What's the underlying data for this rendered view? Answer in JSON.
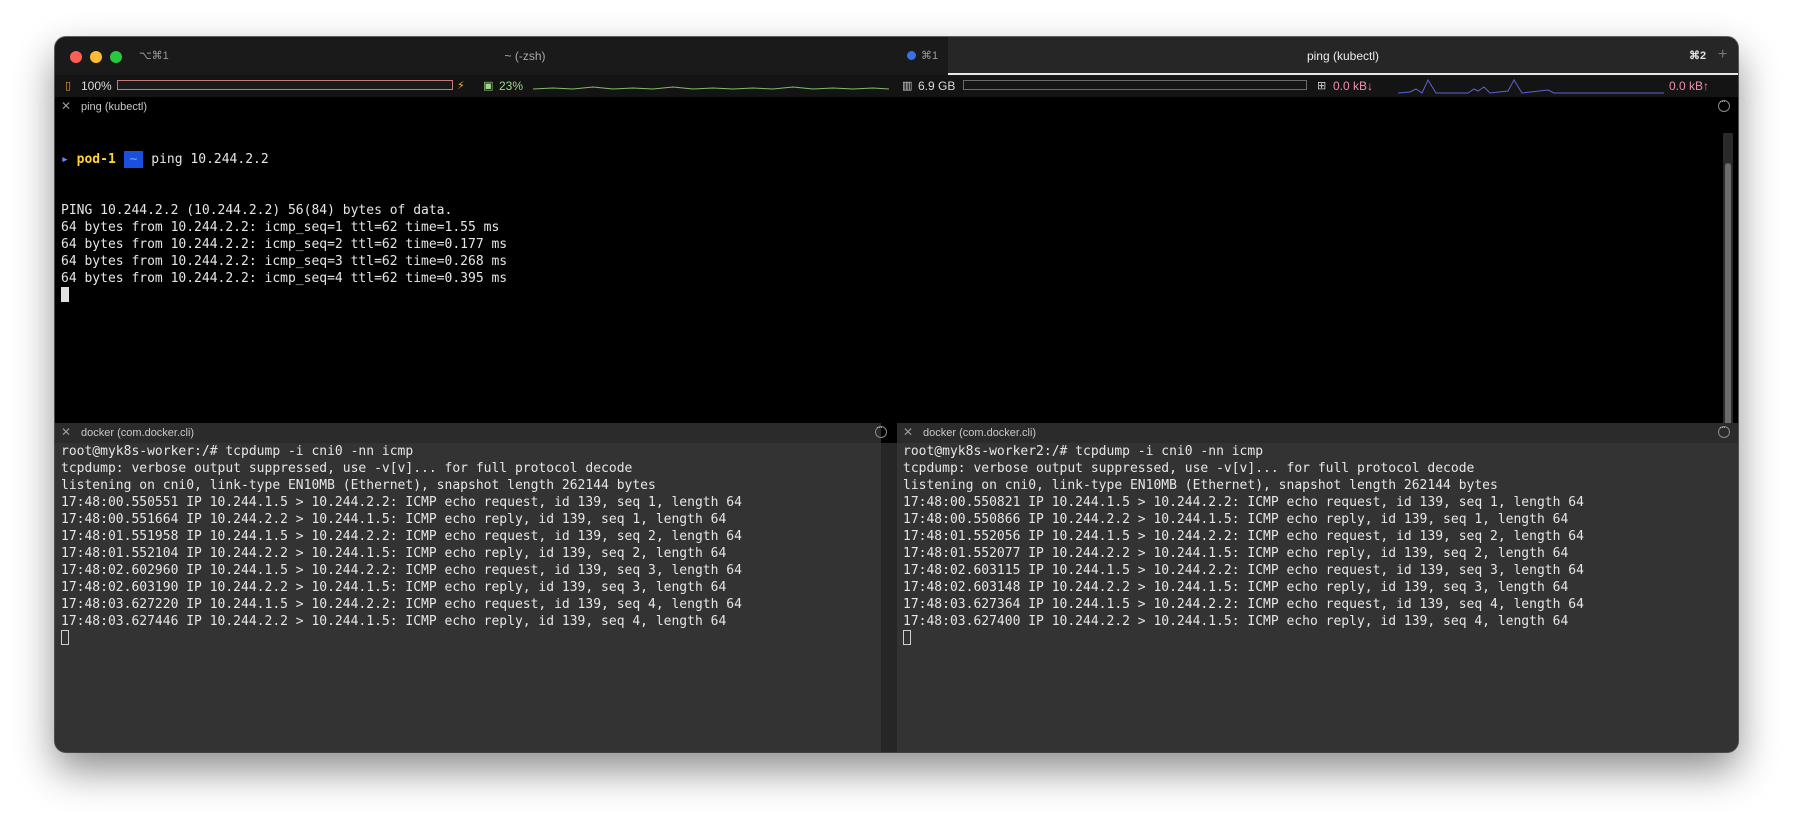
{
  "tabs": [
    {
      "shortcut_left": "⌥⌘1",
      "title": "~ (-zsh)",
      "shortcut_right": "⌘1",
      "active": false
    },
    {
      "title": "ping (kubectl)",
      "shortcut_right": "⌘2",
      "active": true
    }
  ],
  "status": {
    "battery": "100%",
    "battery_fill": 1.0,
    "cpu": "23%",
    "memory": "6.9 GB",
    "net_down": "0.0 kB↓",
    "net_up": "0.0 kB↑"
  },
  "colors": {
    "accent_blue": "#1a4fe0",
    "prompt_yellow": "#ffd43b",
    "cpu_graph": "#7fbf6a",
    "net_graph": "#5b63d9",
    "battery_bar": "#c97a7a"
  },
  "panes": {
    "top": {
      "title": "ping (kubectl)",
      "prompt_context": "pod-1",
      "prompt_dir": "~",
      "command": "ping 10.244.2.2",
      "lines": [
        "PING 10.244.2.2 (10.244.2.2) 56(84) bytes of data.",
        "64 bytes from 10.244.2.2: icmp_seq=1 ttl=62 time=1.55 ms",
        "64 bytes from 10.244.2.2: icmp_seq=2 ttl=62 time=0.177 ms",
        "64 bytes from 10.244.2.2: icmp_seq=3 ttl=62 time=0.268 ms",
        "64 bytes from 10.244.2.2: icmp_seq=4 ttl=62 time=0.395 ms"
      ]
    },
    "bottom_left": {
      "title": "docker (com.docker.cli)",
      "lines": [
        "root@myk8s-worker:/# tcpdump -i cni0 -nn icmp",
        "tcpdump: verbose output suppressed, use -v[v]... for full protocol decode",
        "listening on cni0, link-type EN10MB (Ethernet), snapshot length 262144 bytes",
        "17:48:00.550551 IP 10.244.1.5 > 10.244.2.2: ICMP echo request, id 139, seq 1, length 64",
        "17:48:00.551664 IP 10.244.2.2 > 10.244.1.5: ICMP echo reply, id 139, seq 1, length 64",
        "17:48:01.551958 IP 10.244.1.5 > 10.244.2.2: ICMP echo request, id 139, seq 2, length 64",
        "17:48:01.552104 IP 10.244.2.2 > 10.244.1.5: ICMP echo reply, id 139, seq 2, length 64",
        "17:48:02.602960 IP 10.244.1.5 > 10.244.2.2: ICMP echo request, id 139, seq 3, length 64",
        "17:48:02.603190 IP 10.244.2.2 > 10.244.1.5: ICMP echo reply, id 139, seq 3, length 64",
        "17:48:03.627220 IP 10.244.1.5 > 10.244.2.2: ICMP echo request, id 139, seq 4, length 64",
        "17:48:03.627446 IP 10.244.2.2 > 10.244.1.5: ICMP echo reply, id 139, seq 4, length 64"
      ]
    },
    "bottom_right": {
      "title": "docker (com.docker.cli)",
      "lines": [
        "root@myk8s-worker2:/# tcpdump -i cni0 -nn icmp",
        "tcpdump: verbose output suppressed, use -v[v]... for full protocol decode",
        "listening on cni0, link-type EN10MB (Ethernet), snapshot length 262144 bytes",
        "17:48:00.550821 IP 10.244.1.5 > 10.244.2.2: ICMP echo request, id 139, seq 1, length 64",
        "17:48:00.550866 IP 10.244.2.2 > 10.244.1.5: ICMP echo reply, id 139, seq 1, length 64",
        "17:48:01.552056 IP 10.244.1.5 > 10.244.2.2: ICMP echo request, id 139, seq 2, length 64",
        "17:48:01.552077 IP 10.244.2.2 > 10.244.1.5: ICMP echo reply, id 139, seq 2, length 64",
        "17:48:02.603115 IP 10.244.1.5 > 10.244.2.2: ICMP echo request, id 139, seq 3, length 64",
        "17:48:02.603148 IP 10.244.2.2 > 10.244.1.5: ICMP echo reply, id 139, seq 3, length 64",
        "17:48:03.627364 IP 10.244.1.5 > 10.244.2.2: ICMP echo request, id 139, seq 4, length 64",
        "17:48:03.627400 IP 10.244.2.2 > 10.244.1.5: ICMP echo reply, id 139, seq 4, length 64"
      ]
    }
  }
}
